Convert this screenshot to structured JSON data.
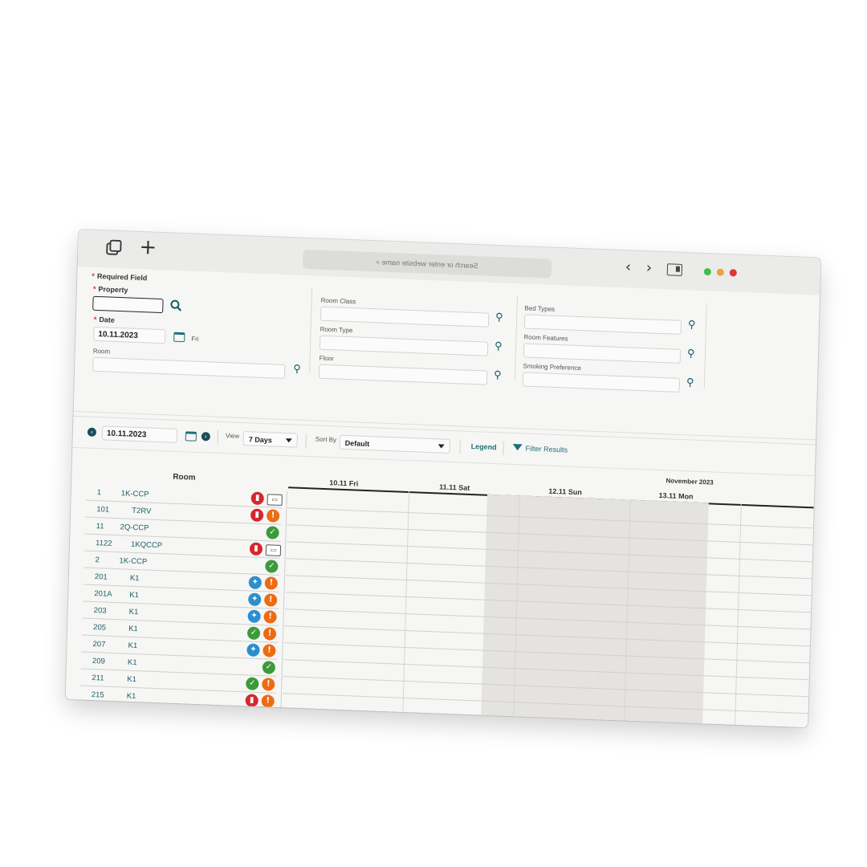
{
  "browser": {
    "url_placeholder": "Search or enter website name",
    "search_glyph": "⌕",
    "back_glyph": "‹",
    "forward_glyph": "›",
    "plus_glyph": "+"
  },
  "form": {
    "required_note": "Required Field",
    "property_label": "Property",
    "property_value": "",
    "date_label": "Date",
    "date_value": "10.11.2023",
    "date_day": "Fri",
    "room_label": "Room",
    "room_class_label": "Room Class",
    "room_type_label": "Room Type",
    "floor_label": "Floor",
    "bed_types_label": "Bed Types",
    "room_features_label": "Room Features",
    "smoking_label": "Smoking Preference",
    "lookup_glyph": "⚲"
  },
  "toolbar": {
    "date_value": "10.11.2023",
    "prev_glyph": "‹",
    "next_glyph": "›",
    "view_label": "View",
    "view_value": "7 Days",
    "sort_label": "Sort By",
    "sort_value": "Default",
    "legend_label": "Legend",
    "filter_label": "Filter Results"
  },
  "grid": {
    "month": "November 2023",
    "room_header": "Room",
    "days": [
      "10.11 Fri",
      "11.11 Sat",
      "12.11 Sun",
      "13.11 Mon"
    ],
    "weekend_days": [
      "11.11 Sat",
      "12.11 Sun"
    ],
    "rooms": [
      {
        "number": "1",
        "type": "1K-CCP",
        "icons": [
          "dirty",
          "do-not-disturb"
        ]
      },
      {
        "number": "101",
        "type": "T2RV",
        "icons": [
          "dirty",
          "alert"
        ]
      },
      {
        "number": "11",
        "type": "2Q-CCP",
        "icons": [
          "inspected"
        ]
      },
      {
        "number": "1122",
        "type": "1KQCCP",
        "icons": [
          "dirty",
          "do-not-disturb"
        ]
      },
      {
        "number": "2",
        "type": "1K-CCP",
        "icons": [
          "inspected"
        ]
      },
      {
        "number": "201",
        "type": "K1",
        "icons": [
          "clean",
          "alert"
        ]
      },
      {
        "number": "201A",
        "type": "K1",
        "icons": [
          "clean",
          "alert"
        ]
      },
      {
        "number": "203",
        "type": "K1",
        "icons": [
          "clean",
          "alert"
        ]
      },
      {
        "number": "205",
        "type": "K1",
        "icons": [
          "inspected",
          "alert"
        ]
      },
      {
        "number": "207",
        "type": "K1",
        "icons": [
          "clean",
          "alert"
        ]
      },
      {
        "number": "209",
        "type": "K1",
        "icons": [
          "inspected"
        ]
      },
      {
        "number": "211",
        "type": "K1",
        "icons": [
          "inspected",
          "alert"
        ]
      },
      {
        "number": "215",
        "type": "K1",
        "icons": [
          "dirty",
          "alert"
        ]
      }
    ]
  },
  "icon_glyphs": {
    "dirty": "▮",
    "alert": "!",
    "inspected": "✓",
    "clean": "✦",
    "do-not-disturb": "▭"
  },
  "colors": {
    "accent": "#1f6f7a",
    "dirty": "#d6262f",
    "alert": "#ee6b12",
    "inspected": "#3d9a3a",
    "clean": "#2a8fd0"
  }
}
